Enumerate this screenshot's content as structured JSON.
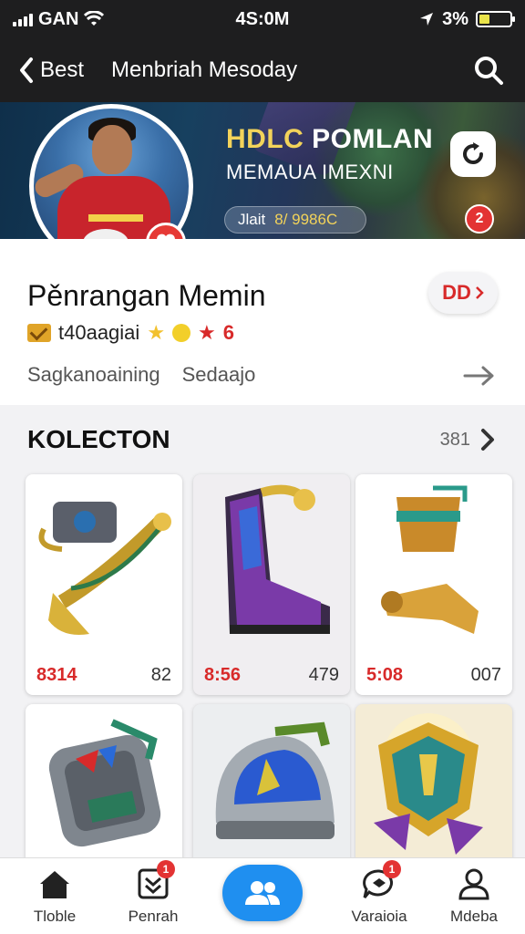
{
  "status_bar": {
    "carrier": "GAN",
    "time": "4S:0M",
    "battery": "3%"
  },
  "header": {
    "back_label": "Best",
    "title": "Menbriah Mesoday"
  },
  "banner": {
    "title_part1": "HDLC",
    "title_part2": "POMLAN",
    "subtitle": "MEMAUA IMEXNI",
    "pill_label": "Jlait",
    "pill_value": "8/ 9986C",
    "badge": "2"
  },
  "profile": {
    "name": "Pěnrangan Memin",
    "stat_text": "t40aagiai",
    "stat_count": "6",
    "link1": "Sagkanoaining",
    "link2": "Sedaajo",
    "button_label": "DD"
  },
  "collection": {
    "title": "KOLECTON",
    "count": "381",
    "items": [
      {
        "price": "8314",
        "qty": "82",
        "name": "brass-horn-item-icon"
      },
      {
        "price": "8:56",
        "qty": "479",
        "name": "purple-boot-item-icon"
      },
      {
        "price": "5:08",
        "qty": "007",
        "name": "golden-pipe-item-icon"
      },
      {
        "name": "metal-armor-item-icon"
      },
      {
        "name": "blue-helmet-item-icon"
      },
      {
        "name": "golden-shield-item-icon"
      }
    ]
  },
  "tabs": [
    {
      "label": "Tloble",
      "icon": "home-icon"
    },
    {
      "label": "Penrah",
      "icon": "inbox-icon",
      "badge": "1"
    },
    {
      "label": "",
      "icon": "group-icon"
    },
    {
      "label": "Varaioia",
      "icon": "chat-icon",
      "badge": "1"
    },
    {
      "label": "Mdeba",
      "icon": "profile-icon"
    }
  ],
  "colors": {
    "accent": "#1f8ff0",
    "alert": "#d82a2a",
    "header": "#1e1e1f",
    "gold": "#f3d35a"
  }
}
